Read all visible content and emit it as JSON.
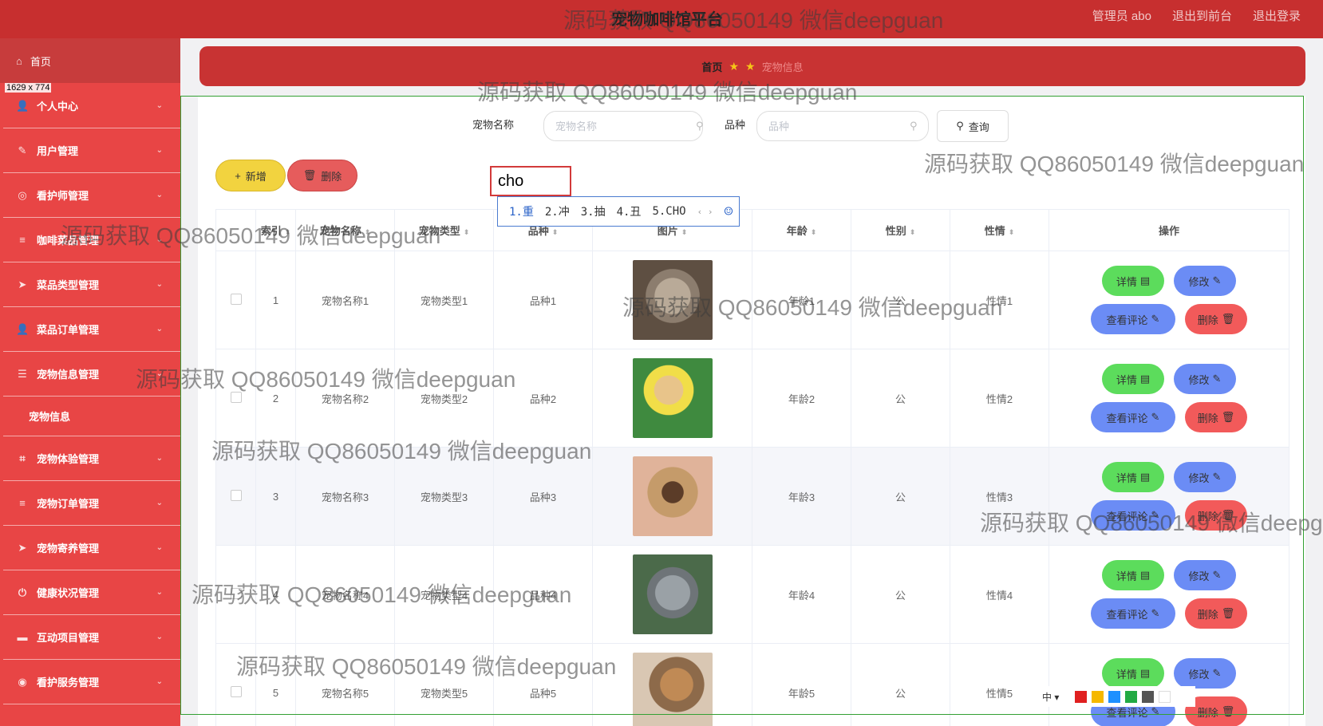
{
  "header": {
    "title": "宠物咖啡馆平台",
    "links": [
      "管理员 abo",
      "退出到前台",
      "退出登录"
    ]
  },
  "sidebar": {
    "home": "首页",
    "size_indicator": "1629 x 774",
    "items": [
      {
        "label": "个人中心",
        "icon": "person-icon"
      },
      {
        "label": "用户管理",
        "icon": "user-edit-icon"
      },
      {
        "label": "看护师管理",
        "icon": "caretaker-icon"
      },
      {
        "label": "咖啡菜品管理",
        "icon": "list-icon"
      },
      {
        "label": "菜品类型管理",
        "icon": "send-icon"
      },
      {
        "label": "菜品订单管理",
        "icon": "person-icon"
      },
      {
        "label": "宠物信息管理",
        "icon": "settings-icon"
      },
      {
        "label": "宠物体验管理",
        "icon": "crop-icon"
      },
      {
        "label": "宠物订单管理",
        "icon": "list-icon"
      },
      {
        "label": "宠物寄养管理",
        "icon": "send-icon"
      },
      {
        "label": "健康状况管理",
        "icon": "power-icon"
      },
      {
        "label": "互动项目管理",
        "icon": "box-icon"
      },
      {
        "label": "看护服务管理",
        "icon": "compass-icon"
      }
    ],
    "active_sub": "宠物信息"
  },
  "breadcrumb": {
    "home": "首页",
    "current": "宠物信息"
  },
  "search": {
    "name_label": "宠物名称",
    "name_placeholder": "宠物名称",
    "breed_label": "品种",
    "breed_placeholder": "品种",
    "query_button": "查询"
  },
  "toolbar": {
    "add": "新增",
    "delete": "删除"
  },
  "ime": {
    "input_text": "cho",
    "candidates": [
      "1.重",
      "2.冲",
      "3.抽",
      "4.丑",
      "5.CHO"
    ],
    "arrows": "‹ ›",
    "lang": "中",
    "palette": [
      "#e02020",
      "#f5b800",
      "#1e90ff",
      "#22aa44",
      "#555555",
      "#ffffff"
    ]
  },
  "table": {
    "headers": [
      "索引",
      "宠物名称",
      "宠物类型",
      "品种",
      "图片",
      "年龄",
      "性别",
      "性情",
      "操作"
    ],
    "rows": [
      {
        "index": "1",
        "name": "宠物名称1",
        "type": "宠物类型1",
        "breed": "品种1",
        "image": "gray-kitten",
        "age": "年龄1",
        "gender": "公",
        "temper": "性情1"
      },
      {
        "index": "2",
        "name": "宠物名称2",
        "type": "宠物类型2",
        "breed": "品种2",
        "image": "puppy-with-ball",
        "age": "年龄2",
        "gender": "公",
        "temper": "性情2"
      },
      {
        "index": "3",
        "name": "宠物名称3",
        "type": "宠物类型3",
        "breed": "品种3",
        "image": "pug-lying",
        "age": "年龄3",
        "gender": "公",
        "temper": "性情3"
      },
      {
        "index": "4",
        "name": "宠物名称4",
        "type": "宠物类型4",
        "breed": "品种4",
        "image": "chinchilla",
        "age": "年龄4",
        "gender": "公",
        "temper": "性情4"
      },
      {
        "index": "5",
        "name": "宠物名称5",
        "type": "宠物类型5",
        "breed": "品种5",
        "image": "dog-playing",
        "age": "年龄5",
        "gender": "公",
        "temper": "性情5"
      }
    ],
    "ops": {
      "detail": "详情",
      "edit": "修改",
      "review": "查看评论",
      "delete": "删除"
    }
  },
  "watermark": "源码获取 QQ86050149 微信deepguan"
}
